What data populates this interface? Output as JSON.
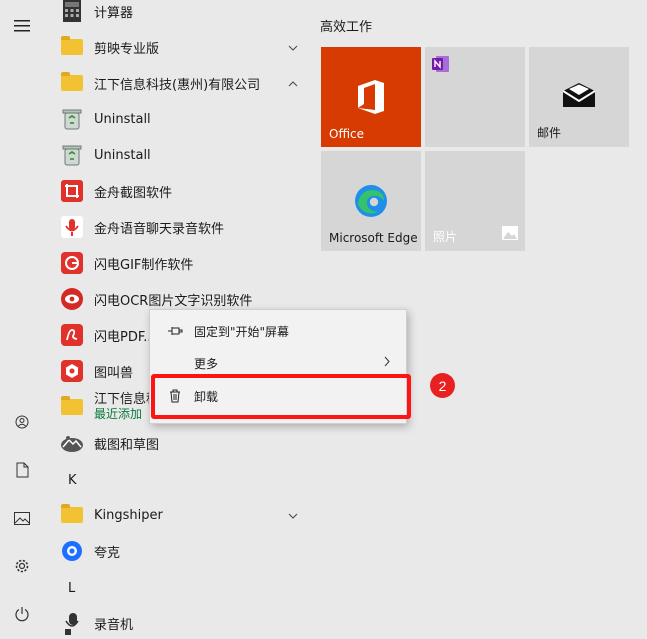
{
  "apps": {
    "calculator": "计算器",
    "jianying": "剪映专业版",
    "jiangxia_folder": "江下信息科技(惠州)有限公司",
    "uninstall1": "Uninstall",
    "uninstall2": "Uninstall",
    "jinzhou_screenshot": "金舟截图软件",
    "jinzhou_voice": "金舟语音聊天录音软件",
    "gif_maker": "闪电GIF制作软件",
    "ocr": "闪电OCR图片文字识别软件",
    "pdf": "闪电PDF...",
    "tujiaojiao": "图叫兽",
    "jiangxia2": "江下信息科",
    "recent": "最近添加",
    "snip": "截图和草图",
    "letter_k": "K",
    "kingshiper": "Kingshiper",
    "kuake": "夸克",
    "letter_l": "L",
    "recorder": "录音机"
  },
  "tiles": {
    "group_title": "高效工作",
    "office": "Office",
    "mail": "邮件",
    "edge": "Microsoft Edge",
    "photos": "照片"
  },
  "context_menu": {
    "pin": "固定到\"开始\"屏幕",
    "more": "更多",
    "uninstall": "卸载"
  },
  "annotation": {
    "step": "2"
  },
  "colors": {
    "office_tile": "#d83b01",
    "highlight": "#ff1414",
    "recent_text": "#0d7a3d"
  }
}
